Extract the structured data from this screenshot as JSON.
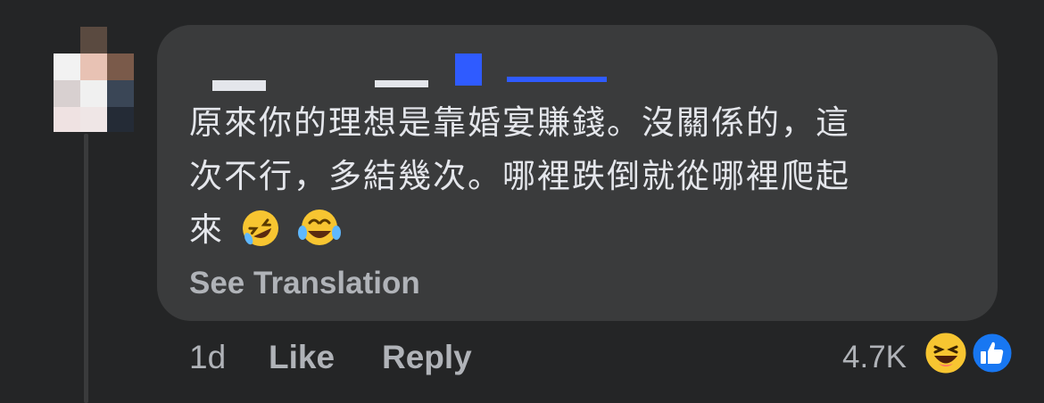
{
  "comment": {
    "text_line1": "原來你的理想是靠婚宴賺錢。沒關係的，這",
    "text_line2": "次不行，多結幾次。哪裡跌倒就從哪裡爬起",
    "text_line3": "來",
    "trailing_emojis": [
      "rolling-on-floor-laughing",
      "grinning-squinting-tears"
    ],
    "see_translation": "See Translation"
  },
  "actions": {
    "time": "1d",
    "like": "Like",
    "reply": "Reply"
  },
  "reactions": {
    "count": "4.7K",
    "types": [
      "haha",
      "like"
    ],
    "like_color": "#1877f2",
    "haha_color": "#f7c531"
  },
  "theme": {
    "background": "#242526",
    "bubble": "#3a3b3c",
    "text": "#e4e6eb",
    "secondary_text": "#b0b3b8"
  }
}
